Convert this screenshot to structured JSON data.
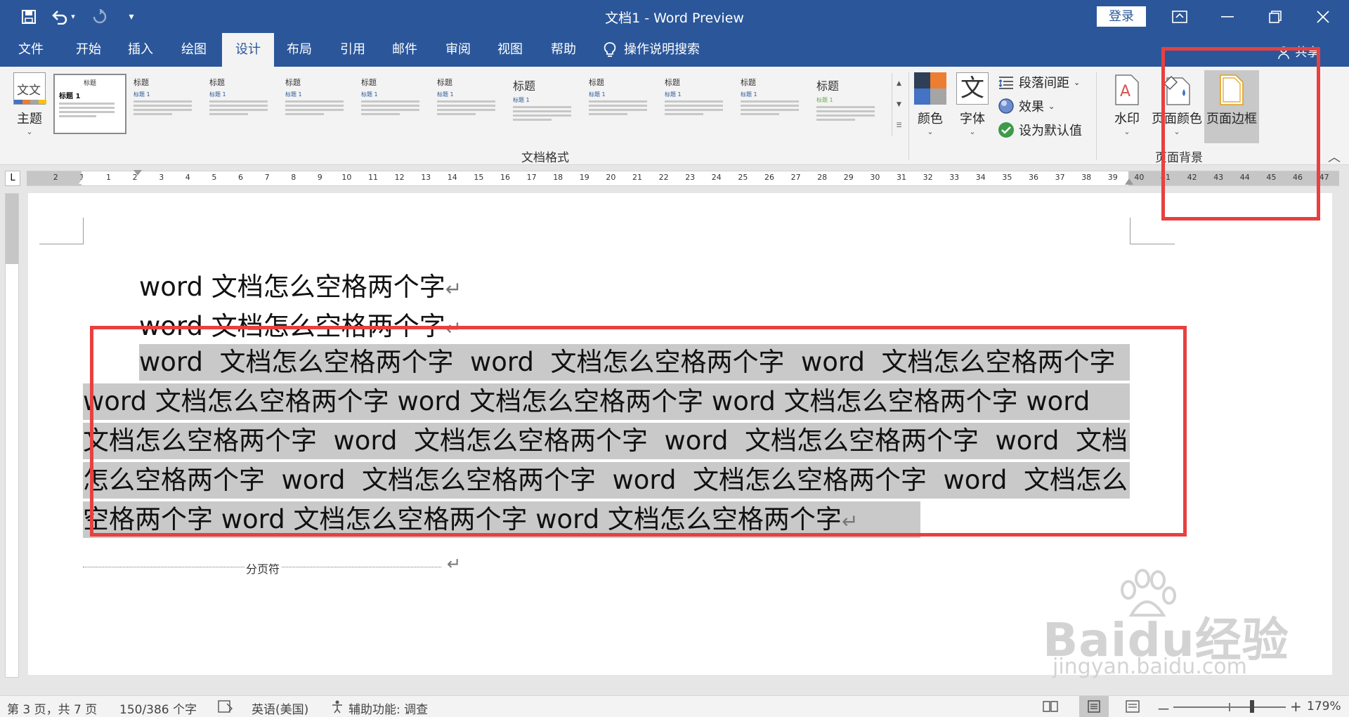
{
  "titlebar": {
    "title": "文档1 - Word Preview",
    "login_label": "登录",
    "save_icon": "save-icon",
    "undo_icon": "undo-icon",
    "redo_icon": "redo-icon",
    "customize_icon": "customize-icon"
  },
  "menu": {
    "tabs": [
      "文件",
      "开始",
      "插入",
      "绘图",
      "设计",
      "布局",
      "引用",
      "邮件",
      "审阅",
      "视图",
      "帮助"
    ],
    "active": "设计",
    "search_label": "操作说明搜索",
    "share_label": "共享"
  },
  "ribbon": {
    "theme_label": "主题",
    "theme_icon_text": "文文",
    "style_thumbs": [
      {
        "title": "标题",
        "heading": "标题 1"
      },
      {
        "title": "标题",
        "heading": "标题 1"
      },
      {
        "title": "标题",
        "heading": "标题 1"
      },
      {
        "title": "标题",
        "heading": "标题 1"
      },
      {
        "title": "标题",
        "heading": "标题 1"
      },
      {
        "title": "标题",
        "heading": "标题 1"
      },
      {
        "title": "标题",
        "heading": "标题 1"
      },
      {
        "title": "标题",
        "heading": "标题 1"
      },
      {
        "title": "标题",
        "heading": "标题 1"
      },
      {
        "title": "标题",
        "heading": "标题 1"
      },
      {
        "title": "标题",
        "heading": "标题 1"
      }
    ],
    "group_document_format": "文档格式",
    "colors_label": "颜色",
    "fonts_label": "字体",
    "fonts_icon_text": "文",
    "paragraph_spacing_label": "段落间距",
    "effects_label": "效果",
    "set_default_label": "设为默认值",
    "watermark_label": "水印",
    "page_color_label": "页面颜色",
    "page_borders_label": "页面边框",
    "group_page_background": "页面背景"
  },
  "ruler": {
    "left_numbers": [
      "2",
      "1"
    ],
    "numbers": [
      "1",
      "2",
      "3",
      "4",
      "5",
      "6",
      "7",
      "8",
      "9",
      "10",
      "11",
      "12",
      "13",
      "14",
      "15",
      "16",
      "17",
      "18",
      "19",
      "20",
      "21",
      "22",
      "23",
      "24",
      "25",
      "26",
      "27",
      "28",
      "29",
      "30",
      "31",
      "32",
      "33",
      "34",
      "35",
      "36",
      "37",
      "38",
      "39",
      "40",
      "41",
      "42",
      "43",
      "44",
      "45",
      "46",
      "47"
    ],
    "corner_label": "L"
  },
  "document": {
    "line1": "word 文档怎么空格两个字",
    "line2": "word 文档怎么空格两个字",
    "para_lines": [
      "word  文档怎么空格两个字  word  文档怎么空格两个字  word  文档怎么空格两个字",
      "word 文档怎么空格两个字 word 文档怎么空格两个字 word 文档怎么空格两个字 word",
      "文档怎么空格两个字  word  文档怎么空格两个字  word  文档怎么空格两个字  word  文档",
      "怎么空格两个字  word  文档怎么空格两个字  word  文档怎么空格两个字  word  文档怎么",
      "空格两个字 word 文档怎么空格两个字 word 文档怎么空格两个字"
    ],
    "paragraph_mark": "↵",
    "page_break_label": "分页符"
  },
  "statusbar": {
    "page_info": "第 3 页，共 7 页",
    "word_count": "150/386 个字",
    "language": "英语(美国)",
    "accessibility": "辅助功能: 调查",
    "zoom": "179%",
    "zoom_minus": "－",
    "zoom_plus": "+",
    "zoom_level": 0.7
  },
  "watermark": {
    "brand": "Baidu经验",
    "url": "jingyan.baidu.com"
  },
  "colors": {
    "word_blue": "#2b579a",
    "ribbon_bg": "#f3f3f3",
    "highlight": "#c9c9c9",
    "annotation_red": "#e8403f"
  }
}
